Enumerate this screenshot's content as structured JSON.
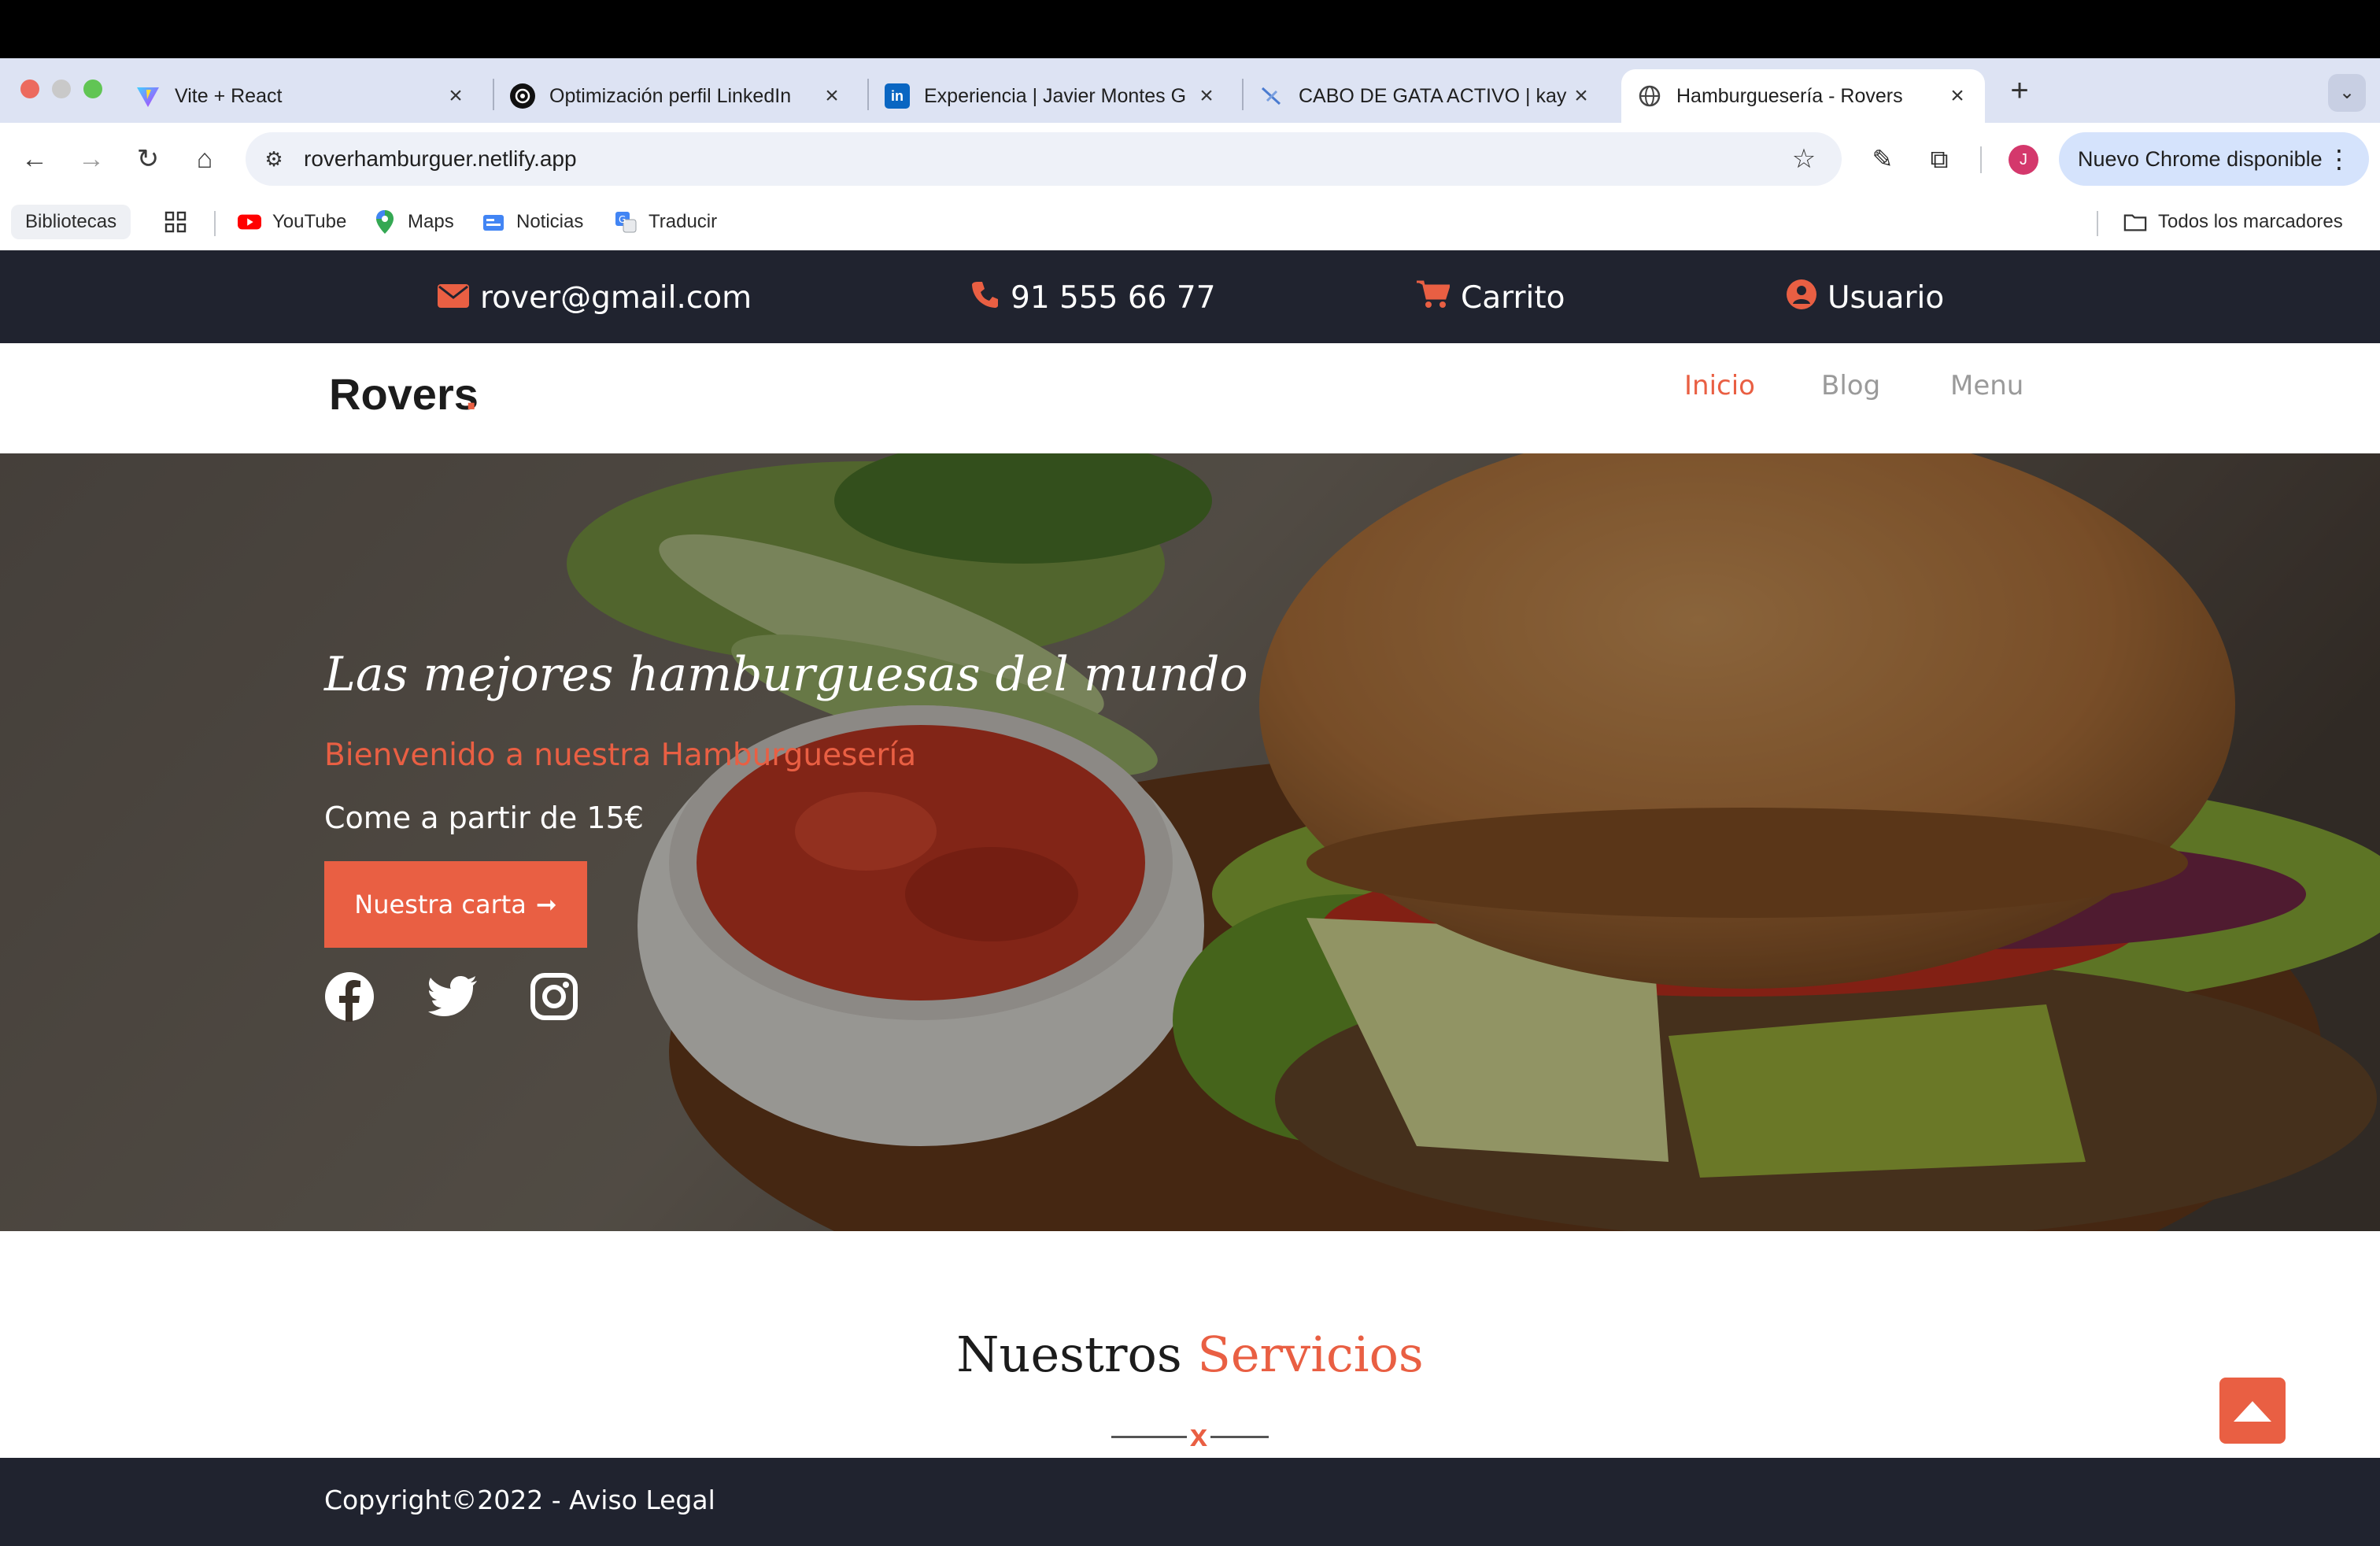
{
  "browser": {
    "tabs": [
      {
        "title": "Vite + React",
        "icon": "vite-icon"
      },
      {
        "title": "Optimización perfil LinkedIn",
        "icon": "openai-icon"
      },
      {
        "title": "Experiencia | Javier Montes G",
        "icon": "linkedin-icon"
      },
      {
        "title": "CABO DE GATA ACTIVO | kay",
        "icon": "kayak-icon"
      },
      {
        "title": "Hamburguesería - Rovers",
        "icon": "globe-icon",
        "active": true
      }
    ],
    "url": "roverhamburguer.netlify.app",
    "profile_initial": "J",
    "update_label": "Nuevo Chrome disponible",
    "bookmarks": {
      "libraries": "Bibliotecas",
      "items": [
        "YouTube",
        "Maps",
        "Noticias",
        "Traducir"
      ],
      "all": "Todos los marcadores"
    }
  },
  "topbar": {
    "email": "rover@gmail.com",
    "phone": "91 555 66 77",
    "cart": "Carrito",
    "user": "Usuario"
  },
  "header": {
    "logo": "Rovers",
    "logo_dot": ".",
    "nav": [
      "Inicio",
      "Blog",
      "Menu"
    ],
    "active_nav": "Inicio"
  },
  "hero": {
    "title": "Las mejores hamburguesas del mundo",
    "subtitle": "Bienvenido a nuestra Hamburguesería",
    "price": "Come a partir de 15€",
    "cta": "Nuestra carta"
  },
  "services": {
    "title_main": "Nuestros",
    "title_accent": "Servicios",
    "divider_mark": "x"
  },
  "footer": {
    "text": "Copyright©2022 - Aviso Legal"
  },
  "colors": {
    "accent": "#e95f43",
    "dark": "#20232f"
  }
}
